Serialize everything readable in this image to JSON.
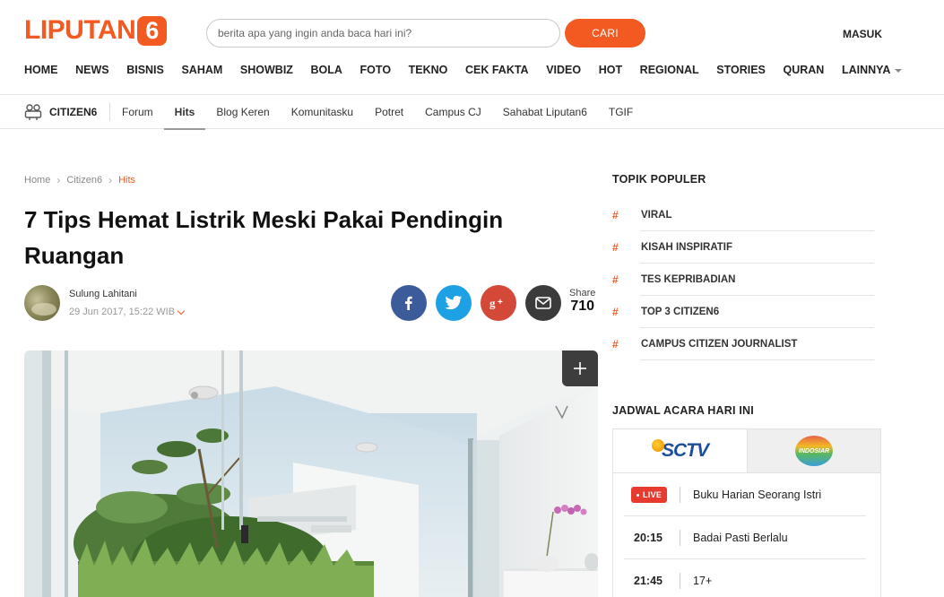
{
  "header": {
    "logo_text": "LIPUTAN",
    "logo_badge": "6",
    "search_placeholder": "berita apa yang ingin anda baca hari ini?",
    "search_button": "CARI",
    "login": "MASUK"
  },
  "nav": {
    "items": [
      "HOME",
      "NEWS",
      "BISNIS",
      "SAHAM",
      "SHOWBIZ",
      "BOLA",
      "FOTO",
      "TEKNO",
      "CEK FAKTA",
      "VIDEO",
      "HOT",
      "REGIONAL",
      "STORIES",
      "QURAN",
      "LAINNYA"
    ]
  },
  "subnav": {
    "section": "CITIZEN6",
    "items": [
      "Forum",
      "Hits",
      "Blog Keren",
      "Komunitasku",
      "Potret",
      "Campus CJ",
      "Sahabat Liputan6",
      "TGIF"
    ],
    "active": "Hits"
  },
  "article": {
    "breadcrumb": [
      "Home",
      "Citizen6",
      "Hits"
    ],
    "title": "7 Tips Hemat Listrik Meski Pakai Pendingin Ruangan",
    "author": "Sulung Lahitani",
    "date": "29 Jun 2017, 15:22 WIB",
    "share_label": "Share",
    "share_count": "710"
  },
  "sidebar": {
    "topik_heading": "TOPIK POPULER",
    "topik_hash": "#",
    "topik": [
      "VIRAL",
      "KISAH INSPIRATIF",
      "TES KEPRIBADIAN",
      "TOP 3 CITIZEN6",
      "CAMPUS CITIZEN JOURNALIST"
    ],
    "jadwal_heading": "JADWAL ACARA HARI INI",
    "channels": [
      "SCTV",
      "INDOSIAR"
    ],
    "schedule": [
      {
        "time": "LIVE",
        "program": "Buku Harian Seorang Istri"
      },
      {
        "time": "20:15",
        "program": "Badai Pasti Berlalu"
      },
      {
        "time": "21:45",
        "program": "17+"
      }
    ]
  },
  "colors": {
    "brand": "#f35a22",
    "facebook": "#3b5b9a",
    "twitter": "#1da1e4",
    "googleplus": "#d34836",
    "email": "#3b3b3b",
    "live": "#e63b2e"
  }
}
